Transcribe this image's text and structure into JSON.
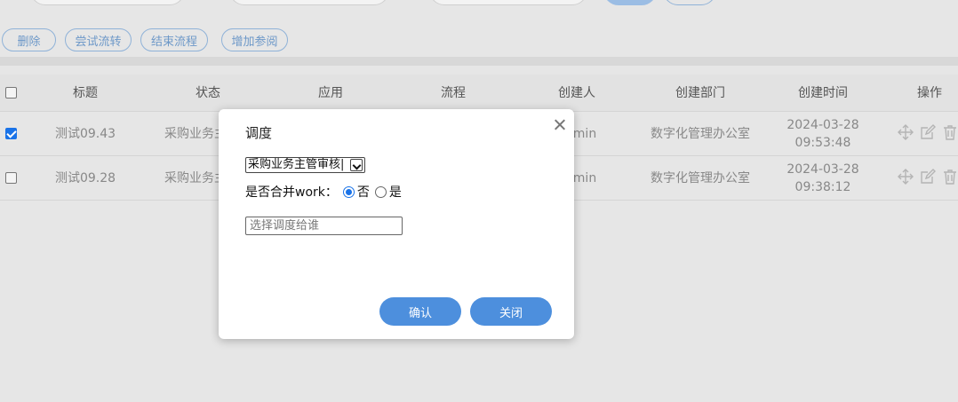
{
  "toolbar": {
    "delete_label": "删除",
    "try_flow_label": "尝试流转",
    "end_flow_label": "结束流程",
    "add_review_label": "增加参阅"
  },
  "table": {
    "columns": [
      "标题",
      "状态",
      "应用",
      "流程",
      "创建人",
      "创建部门",
      "创建时间",
      "操作"
    ],
    "rows": [
      {
        "checked": true,
        "title": "测试09.43",
        "status": "采购业务主",
        "creator": "min",
        "dept": "数字化管理办公室",
        "date": "2024-03-28",
        "time": "09:53:48"
      },
      {
        "checked": false,
        "title": "测试09.28",
        "status": "采购业务主",
        "creator": "min",
        "dept": "数字化管理办公室",
        "date": "2024-03-28",
        "time": "09:38:12"
      }
    ]
  },
  "dialog": {
    "title": "调度",
    "node_select_value": "采购业务主管审核|",
    "merge_label": "是否合并work：",
    "merge_no": "否",
    "merge_yes": "是",
    "merge_selected": "否",
    "assign_placeholder": "选择调度给谁",
    "confirm_label": "确认",
    "close_label": "关闭"
  },
  "colors": {
    "accent": "#4d8fdd",
    "pill_border": "#8fb2d8",
    "checkbox_checked": "#1a73e8"
  },
  "icons": [
    "move-icon",
    "edit-icon",
    "trash-icon",
    "close-icon",
    "chevron-down-icon"
  ]
}
